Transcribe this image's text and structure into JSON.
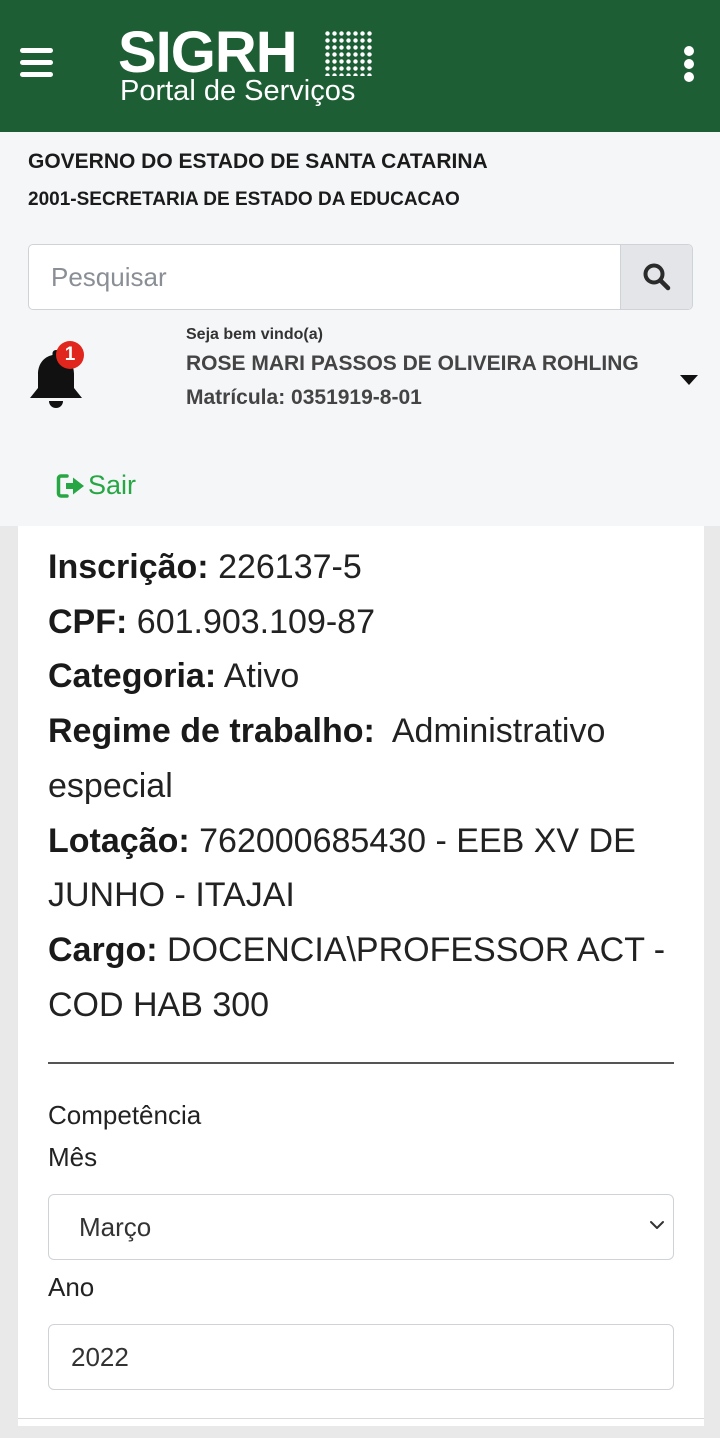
{
  "app": {
    "logo_title": "SIGRH",
    "logo_subtitle": "Portal de Serviços"
  },
  "header": {
    "org_line1": "GOVERNO DO ESTADO DE SANTA CATARINA",
    "org_line2": "2001-SECRETARIA DE ESTADO DA EDUCACAO"
  },
  "search": {
    "placeholder": "Pesquisar",
    "value": ""
  },
  "notifications": {
    "count": "1"
  },
  "user": {
    "welcome": "Seja bem vindo(a)",
    "name": "ROSE MARI PASSOS DE OLIVEIRA ROHLING",
    "matricula_label": "Matrícula:",
    "matricula_value": "0351919-8-01"
  },
  "logout_label": "Sair",
  "profile": {
    "inscricao_label": "Inscrição:",
    "inscricao_value": "226137-5",
    "cpf_label": "CPF:",
    "cpf_value": "601.903.109-87",
    "categoria_label": "Categoria:",
    "categoria_value": "Ativo",
    "regime_label": "Regime de trabalho:",
    "regime_value": "Administrativo especial",
    "lotacao_label": "Lotação:",
    "lotacao_value": "762000685430 - EEB XV DE JUNHO - ITAJAI",
    "cargo_label": "Cargo:",
    "cargo_value": "DOCENCIA\\PROFESSOR ACT - COD HAB 300"
  },
  "form": {
    "competencia_label": "Competência",
    "mes_label": "Mês",
    "mes_selected": "Março",
    "ano_label": "Ano",
    "ano_value": "2022"
  },
  "icons": {
    "menu": "hamburger-icon",
    "more": "kebab-icon",
    "search": "search-icon",
    "bell": "bell-icon",
    "logout": "sign-out-icon",
    "chevron": "chevron-down-icon"
  },
  "colors": {
    "topbar": "#1e5e34",
    "logout": "#27a644",
    "badge": "#e0261d"
  }
}
